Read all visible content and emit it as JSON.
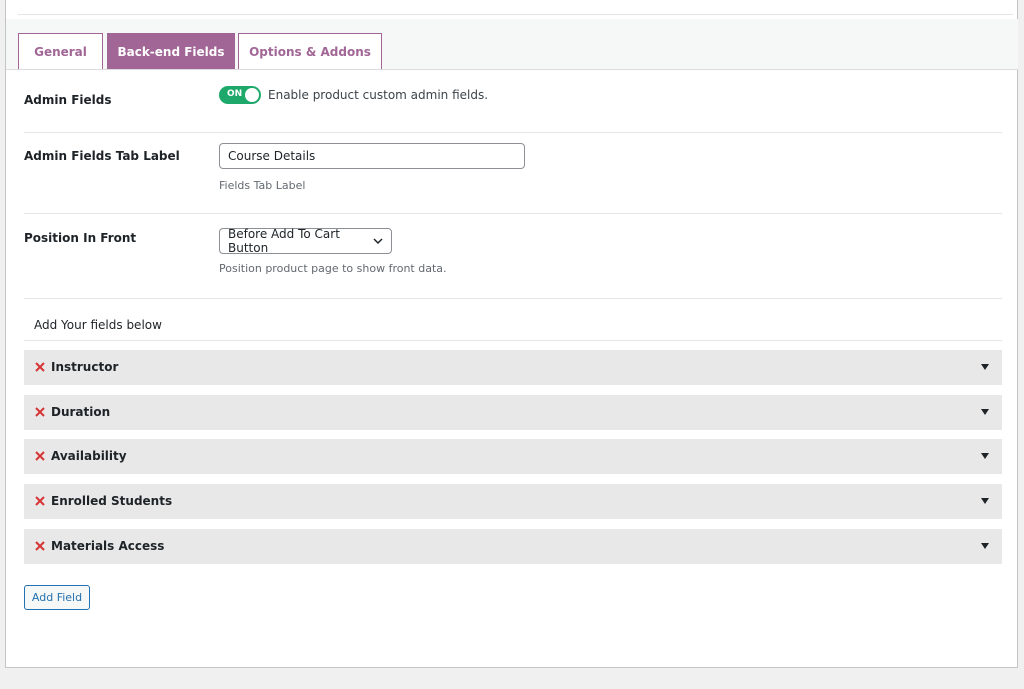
{
  "tabs": [
    {
      "label": "General",
      "active": false
    },
    {
      "label": "Back-end Fields",
      "active": true
    },
    {
      "label": "Options & Addons",
      "active": false
    }
  ],
  "settings": {
    "admin_fields": {
      "label": "Admin Fields",
      "toggle_state": "ON",
      "enabled": true,
      "description": "Enable product custom admin fields."
    },
    "tab_label": {
      "label": "Admin Fields Tab Label",
      "value": "Course Details",
      "help": "Fields Tab Label"
    },
    "position": {
      "label": "Position In Front",
      "selected": "Before Add To Cart Button",
      "help": "Position product page to show front data."
    }
  },
  "fields_section": {
    "intro": "Add Your fields below",
    "items": [
      {
        "name": "Instructor"
      },
      {
        "name": "Duration"
      },
      {
        "name": "Availability"
      },
      {
        "name": "Enrolled Students"
      },
      {
        "name": "Materials Access"
      }
    ],
    "add_button": "Add Field"
  },
  "colors": {
    "accent": "#a16696",
    "toggle_on": "#1ea96b",
    "remove": "#d63638",
    "button": "#2271b1"
  },
  "icons": {
    "remove": "close-icon",
    "expand": "caret-down-icon",
    "select": "chevron-down-icon"
  }
}
